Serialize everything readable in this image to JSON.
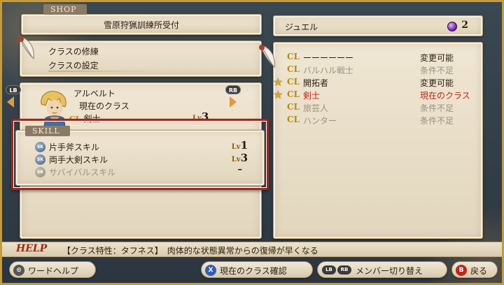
{
  "shop": {
    "section_label": "SHOP",
    "name": "雪原狩猟訓練所受付"
  },
  "menu": {
    "items": [
      {
        "label": "クラスの修練",
        "selected": false
      },
      {
        "label": "クラスの設定",
        "selected": true
      }
    ]
  },
  "character": {
    "name": "アルベルト",
    "current_class_label": "現在のクラス",
    "class_badge": "CL",
    "class_name": "剣士",
    "lv_badge": "Lv",
    "level": "3",
    "left_bumper": "LB",
    "right_bumper": "RB"
  },
  "skills": {
    "section_label": "SKILL",
    "icon_text": "SK",
    "items": [
      {
        "name": "片手斧スキル",
        "lv_badge": "Lv",
        "level": "1",
        "dim": false
      },
      {
        "name": "両手大剣スキル",
        "lv_badge": "Lv",
        "level": "3",
        "dim": false
      },
      {
        "name": "サバイバルスキル",
        "lv_badge": "",
        "level": "–",
        "dim": true
      }
    ]
  },
  "jewel": {
    "label": "ジュエル",
    "count": "2"
  },
  "classes": {
    "badge": "CL",
    "items": [
      {
        "name": "ーーーーーー",
        "status": "変更可能",
        "star": false,
        "style": "normal"
      },
      {
        "name": "バルハル戦士",
        "status": "条件不足",
        "star": false,
        "style": "gray"
      },
      {
        "name": "開拓者",
        "status": "変更可能",
        "star": true,
        "style": "normal"
      },
      {
        "name": "剣士",
        "status": "現在のクラス",
        "star": true,
        "style": "red"
      },
      {
        "name": "旅芸人",
        "status": "条件不足",
        "star": false,
        "style": "gray"
      },
      {
        "name": "ハンター",
        "status": "条件不足",
        "star": false,
        "style": "gray"
      }
    ]
  },
  "help": {
    "label": "HELP",
    "text": "【クラス特性：タフネス】　肉体的な状態異常からの復帰が早くなる"
  },
  "controls": {
    "word_help": {
      "button": "⊙",
      "label": "ワードヘルプ"
    },
    "confirm_class": {
      "button": "X",
      "label": "現在のクラス確認"
    },
    "switch_member": {
      "button_lb": "LB",
      "button_rb": "RB",
      "label": "メンバー切り替え"
    },
    "back": {
      "button": "B",
      "label": "戻る"
    }
  },
  "colors": {
    "frame_gold": "#c79a3a",
    "skill_highlight": "#a3261c",
    "current_class_red": "#c0241a",
    "cl_gold": "#b88a12"
  }
}
